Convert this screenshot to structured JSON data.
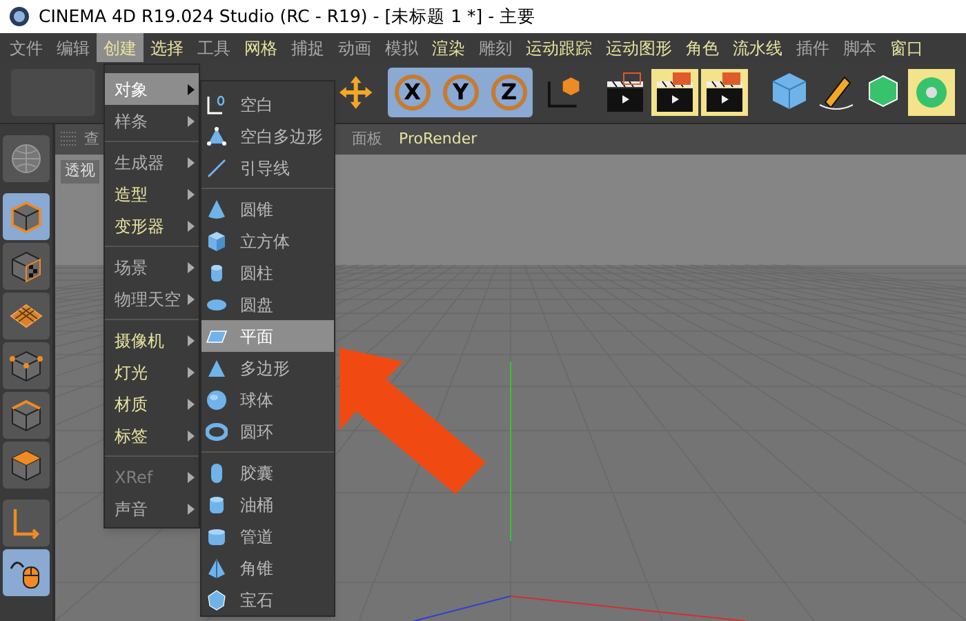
{
  "window": {
    "title": "CINEMA 4D R19.024 Studio (RC - R19) - [未标题 1 *] - 主要"
  },
  "menu_bar": [
    {
      "label": "文件",
      "highlight": false,
      "selected": false
    },
    {
      "label": "编辑",
      "highlight": false,
      "selected": false
    },
    {
      "label": "创建",
      "highlight": true,
      "selected": true
    },
    {
      "label": "选择",
      "highlight": true,
      "selected": false
    },
    {
      "label": "工具",
      "highlight": false,
      "selected": false
    },
    {
      "label": "网格",
      "highlight": true,
      "selected": false
    },
    {
      "label": "捕捉",
      "highlight": false,
      "selected": false
    },
    {
      "label": "动画",
      "highlight": false,
      "selected": false
    },
    {
      "label": "模拟",
      "highlight": false,
      "selected": false
    },
    {
      "label": "渲染",
      "highlight": true,
      "selected": false
    },
    {
      "label": "雕刻",
      "highlight": false,
      "selected": false
    },
    {
      "label": "运动跟踪",
      "highlight": true,
      "selected": false
    },
    {
      "label": "运动图形",
      "highlight": true,
      "selected": false
    },
    {
      "label": "角色",
      "highlight": true,
      "selected": false
    },
    {
      "label": "流水线",
      "highlight": true,
      "selected": false
    },
    {
      "label": "插件",
      "highlight": false,
      "selected": false
    },
    {
      "label": "脚本",
      "highlight": false,
      "selected": false
    },
    {
      "label": "窗口",
      "highlight": true,
      "selected": false
    }
  ],
  "toolbar": {
    "axis_buttons": [
      "X",
      "Y",
      "Z"
    ]
  },
  "left_toolbar": [
    {
      "kind": "globe",
      "selected": false
    },
    {
      "kind": "cube",
      "selected": true
    },
    {
      "kind": "checker",
      "selected": false
    },
    {
      "kind": "grid",
      "selected": false
    },
    {
      "kind": "points",
      "selected": false
    },
    {
      "kind": "edges",
      "selected": false
    },
    {
      "kind": "polygons",
      "selected": false
    },
    {
      "kind": "axis",
      "selected": false
    },
    {
      "kind": "mouse",
      "selected": true
    }
  ],
  "viewport": {
    "tabs": [
      {
        "label": "查",
        "highlight": false
      },
      {
        "label": "面板",
        "highlight": false
      },
      {
        "label": "ProRender",
        "highlight": true
      }
    ],
    "label": "透视"
  },
  "create_menu": {
    "groups": [
      [
        {
          "label": "对象",
          "highlight": false,
          "disabled": false,
          "selected": true
        },
        {
          "label": "样条",
          "highlight": false,
          "disabled": false,
          "selected": false
        }
      ],
      [
        {
          "label": "生成器",
          "highlight": false,
          "disabled": false,
          "selected": false
        },
        {
          "label": "造型",
          "highlight": true,
          "disabled": false,
          "selected": false
        },
        {
          "label": "变形器",
          "highlight": true,
          "disabled": false,
          "selected": false
        }
      ],
      [
        {
          "label": "场景",
          "highlight": false,
          "disabled": false,
          "selected": false
        },
        {
          "label": "物理天空",
          "highlight": false,
          "disabled": false,
          "selected": false
        }
      ],
      [
        {
          "label": "摄像机",
          "highlight": true,
          "disabled": false,
          "selected": false
        },
        {
          "label": "灯光",
          "highlight": true,
          "disabled": false,
          "selected": false
        },
        {
          "label": "材质",
          "highlight": true,
          "disabled": false,
          "selected": false
        },
        {
          "label": "标签",
          "highlight": true,
          "disabled": false,
          "selected": false
        }
      ],
      [
        {
          "label": "XRef",
          "highlight": false,
          "disabled": true,
          "selected": false
        },
        {
          "label": "声音",
          "highlight": false,
          "disabled": false,
          "selected": false
        }
      ]
    ]
  },
  "object_submenu": {
    "groups": [
      [
        {
          "label": "空白",
          "kind": "null",
          "selected": false
        },
        {
          "label": "空白多边形",
          "kind": "polygon_null",
          "selected": false
        },
        {
          "label": "引导线",
          "kind": "guide",
          "selected": false
        }
      ],
      [
        {
          "label": "圆锥",
          "kind": "cone",
          "selected": false
        },
        {
          "label": "立方体",
          "kind": "cube",
          "selected": false
        },
        {
          "label": "圆柱",
          "kind": "cylinder",
          "selected": false
        },
        {
          "label": "圆盘",
          "kind": "disc",
          "selected": false
        },
        {
          "label": "平面",
          "kind": "plane",
          "selected": true
        },
        {
          "label": "多边形",
          "kind": "polygon",
          "selected": false
        },
        {
          "label": "球体",
          "kind": "sphere",
          "selected": false
        },
        {
          "label": "圆环",
          "kind": "torus",
          "selected": false
        }
      ],
      [
        {
          "label": "胶囊",
          "kind": "capsule",
          "selected": false
        },
        {
          "label": "油桶",
          "kind": "oil_tank",
          "selected": false
        },
        {
          "label": "管道",
          "kind": "tube",
          "selected": false
        },
        {
          "label": "角锥",
          "kind": "pyramid",
          "selected": false
        },
        {
          "label": "宝石",
          "kind": "gem",
          "selected": false
        }
      ]
    ]
  }
}
